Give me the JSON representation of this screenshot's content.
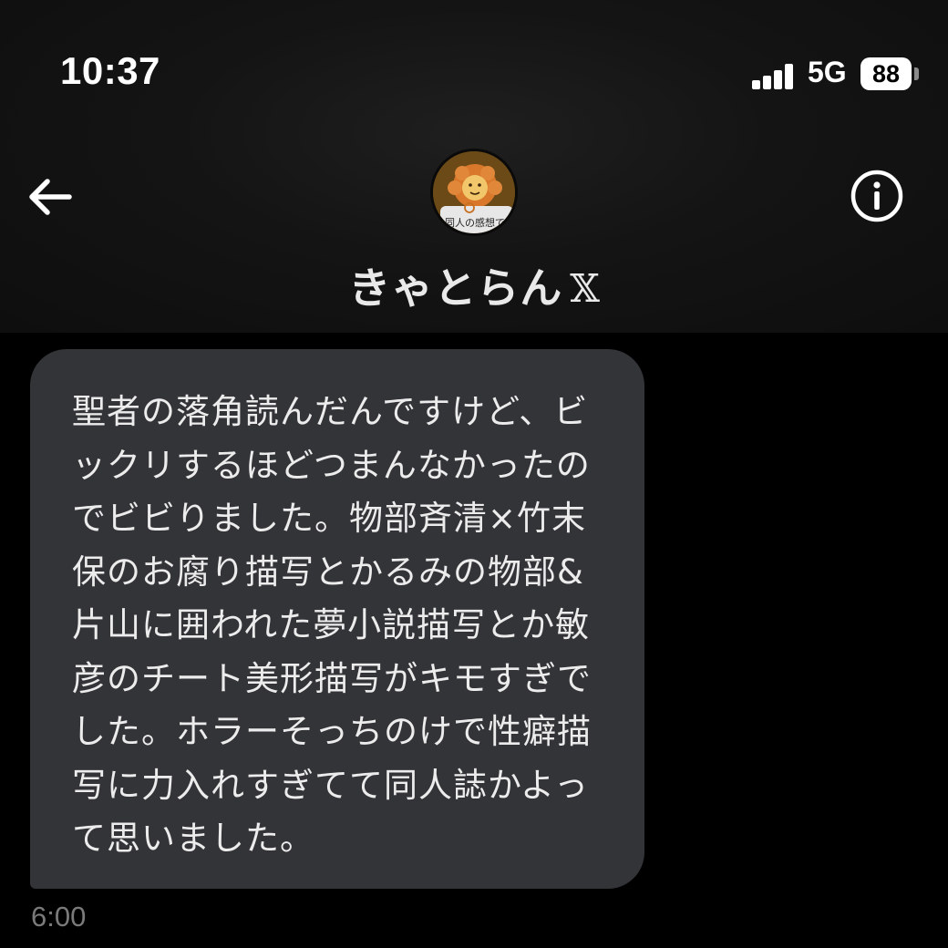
{
  "status_bar": {
    "time": "10:37",
    "network": "5G",
    "battery": "88"
  },
  "header": {
    "contact_name": "きゃとらん",
    "platform_badge": "𝕏",
    "back_icon": "arrow-left-icon",
    "info_icon": "info-circle-icon",
    "avatar_text": "同人の感想で"
  },
  "messages": [
    {
      "text": "聖者の落角読んだんですけど、ビ\nックリするほどつまんなかったの\nでビビりました。物部斉清×竹末\n保のお腐り描写とかるみの物部&\n片山に囲われた夢小説描写とか敏\n彦のチート美形描写がキモすぎで\nした。ホラーそっちのけで性癖描\n写に力入れすぎてて同人誌かよっ\nて思いました。",
      "time": "6:00"
    }
  ],
  "colors": {
    "bubble": "#333438",
    "background": "#000000",
    "header": "#141414"
  }
}
